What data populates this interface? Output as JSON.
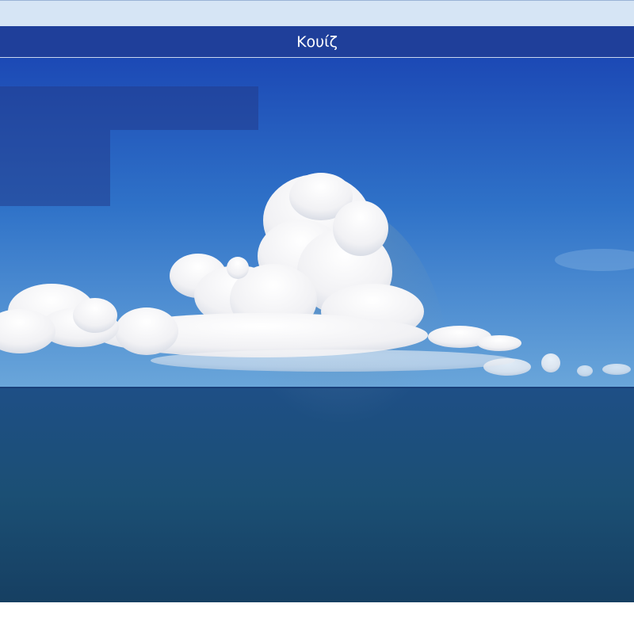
{
  "header": {
    "title": "Κουίζ"
  },
  "image": {
    "subject": "clouds-over-ocean-photo"
  },
  "colors": {
    "top_strip": "#d6e5f5",
    "title_bar": "#1f3f9a",
    "sky_top": "#1d4bb8",
    "sky_horizon": "#5f9fd8",
    "sea": "#1b4e78"
  }
}
